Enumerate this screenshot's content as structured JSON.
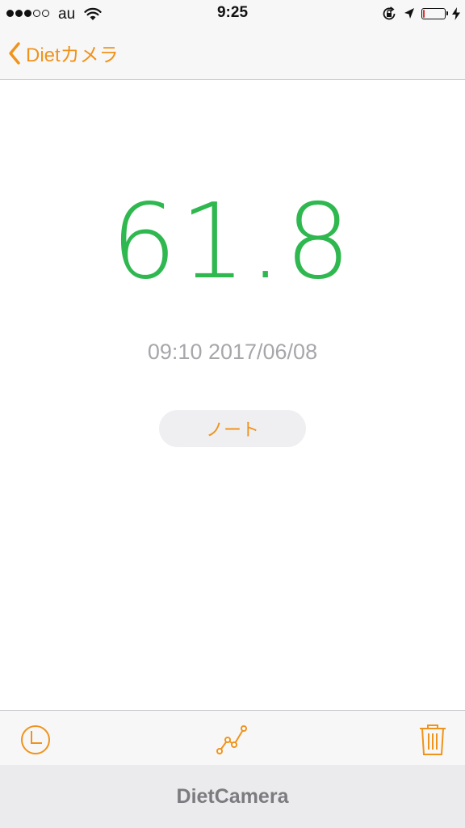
{
  "status_bar": {
    "carrier": "au",
    "time": "9:25",
    "signal_bars_filled": 3,
    "signal_bars_total": 5,
    "battery_level": 0.05,
    "colors": {
      "battery_low": "#e0302a"
    },
    "icons": [
      "wifi-icon",
      "rotation-lock-icon",
      "location-arrow-icon",
      "battery-icon",
      "charging-bolt-icon"
    ]
  },
  "nav": {
    "back_label": "Dietカメラ",
    "back_icon": "chevron-left-icon"
  },
  "record": {
    "weight": "61.8",
    "datetime": "09:10 2017/06/08"
  },
  "note_button": {
    "label": "ノート"
  },
  "toolbar": {
    "icons": [
      "clock-icon",
      "graph-icon",
      "trash-icon"
    ]
  },
  "banner": {
    "label": "DietCamera"
  },
  "colors": {
    "accent": "#f0931b",
    "weight": "#2fb84f",
    "secondary_text": "#a7a7ab"
  }
}
